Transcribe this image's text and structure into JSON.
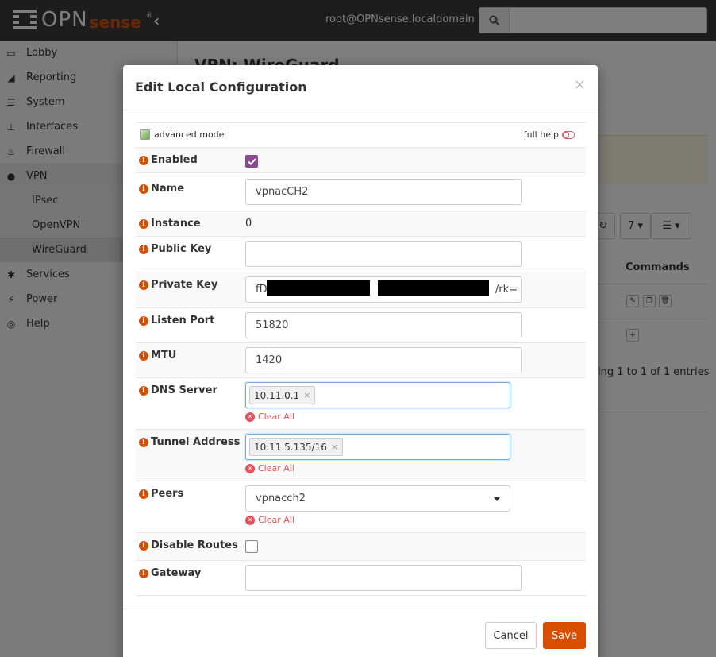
{
  "brand": {
    "name_main": "OPN",
    "name_accent": "sense",
    "registered": "®"
  },
  "header": {
    "user": "root@OPNsense.localdomain",
    "search_placeholder": ""
  },
  "sidebar": {
    "items": [
      {
        "label": "Lobby",
        "icon": "laptop-icon"
      },
      {
        "label": "Reporting",
        "icon": "area-chart-icon"
      },
      {
        "label": "System",
        "icon": "server-icon"
      },
      {
        "label": "Interfaces",
        "icon": "sitemap-icon"
      },
      {
        "label": "Firewall",
        "icon": "fire-icon"
      },
      {
        "label": "VPN",
        "icon": "globe-icon"
      },
      {
        "label": "IPsec"
      },
      {
        "label": "OpenVPN"
      },
      {
        "label": "WireGuard"
      },
      {
        "label": "Services",
        "icon": "cog-icon"
      },
      {
        "label": "Power",
        "icon": "plug-icon"
      },
      {
        "label": "Help",
        "icon": "life-ring-icon"
      }
    ]
  },
  "background": {
    "page_title": "VPN: WireGuard",
    "rows_select": "7",
    "commands_header": "Commands",
    "entries_text": "ing 1 to 1 of 1 entries"
  },
  "modal": {
    "title": "Edit Local Configuration",
    "close": "×",
    "advanced_mode": "advanced mode",
    "full_help": "full help",
    "fields": {
      "enabled": {
        "label": "Enabled",
        "checked": true
      },
      "name": {
        "label": "Name",
        "value": "vpnacCH2"
      },
      "instance": {
        "label": "Instance",
        "value": "0"
      },
      "public_key": {
        "label": "Public Key",
        "value": ""
      },
      "private_key": {
        "label": "Private Key",
        "value_start": "fD",
        "value_end": "/rk="
      },
      "listen_port": {
        "label": "Listen Port",
        "value": "51820"
      },
      "mtu": {
        "label": "MTU",
        "value": "1420"
      },
      "dns_server": {
        "label": "DNS Server",
        "tags": [
          "10.11.0.1"
        ]
      },
      "tunnel_address": {
        "label": "Tunnel Address",
        "tags": [
          "10.11.5.135/16"
        ]
      },
      "peers": {
        "label": "Peers",
        "value": "vpnacch2"
      },
      "disable_routes": {
        "label": "Disable Routes",
        "checked": false
      },
      "gateway": {
        "label": "Gateway",
        "value": ""
      }
    },
    "clear_all": "Clear All",
    "cancel": "Cancel",
    "save": "Save"
  }
}
